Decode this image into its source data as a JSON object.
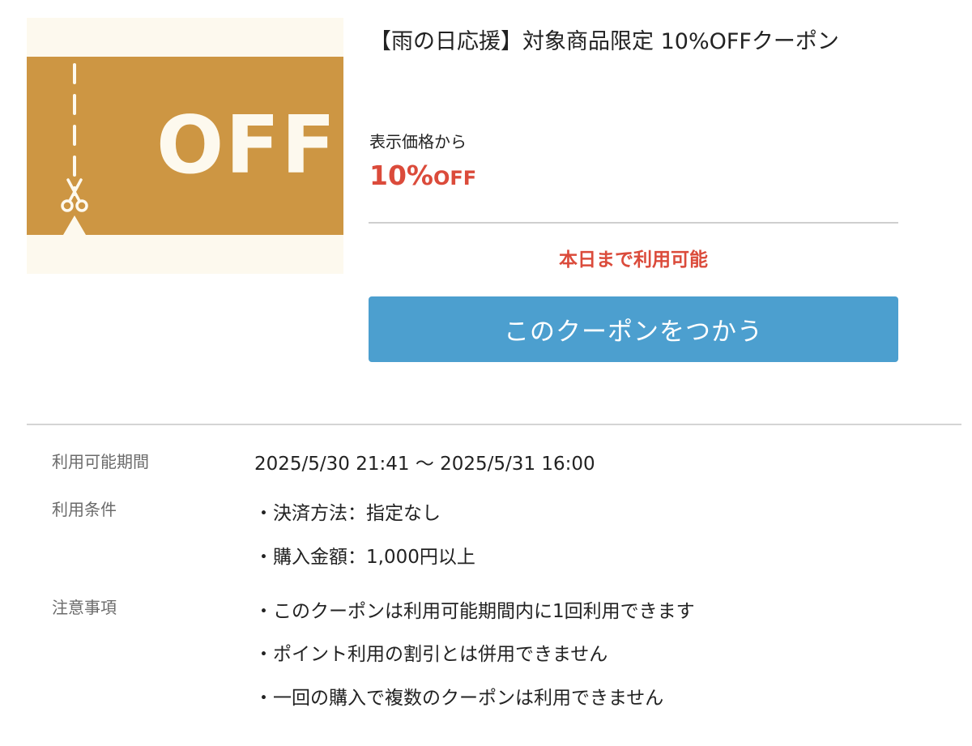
{
  "coupon_image": {
    "text": "OFF",
    "band_color": "#cd9643",
    "background_color": "#fdf9ee",
    "icon": "scissors-icon"
  },
  "coupon": {
    "title": "【雨の日応援】対象商品限定 10%OFFクーポン",
    "price_basis": "表示価格から",
    "discount_value": "10%",
    "discount_unit": "OFF",
    "availability": "本日まで利用可能",
    "use_button_label": "このクーポンをつかう"
  },
  "details": {
    "period": {
      "label": "利用可能期間",
      "value": "2025/5/30 21:41 〜 2025/5/31 16:00"
    },
    "conditions": {
      "label": "利用条件",
      "items": [
        "・決済方法：指定なし",
        "・購入金額：1,000円以上"
      ]
    },
    "notes": {
      "label": "注意事項",
      "items": [
        "・このクーポンは利用可能期間内に1回利用できます",
        "・ポイント利用の割引とは併用できません",
        "・一回の購入で複数のクーポンは利用できません"
      ]
    }
  },
  "colors": {
    "accent_red": "#db4b3b",
    "button_blue": "#4c9fcf",
    "coupon_gold": "#cd9643"
  }
}
